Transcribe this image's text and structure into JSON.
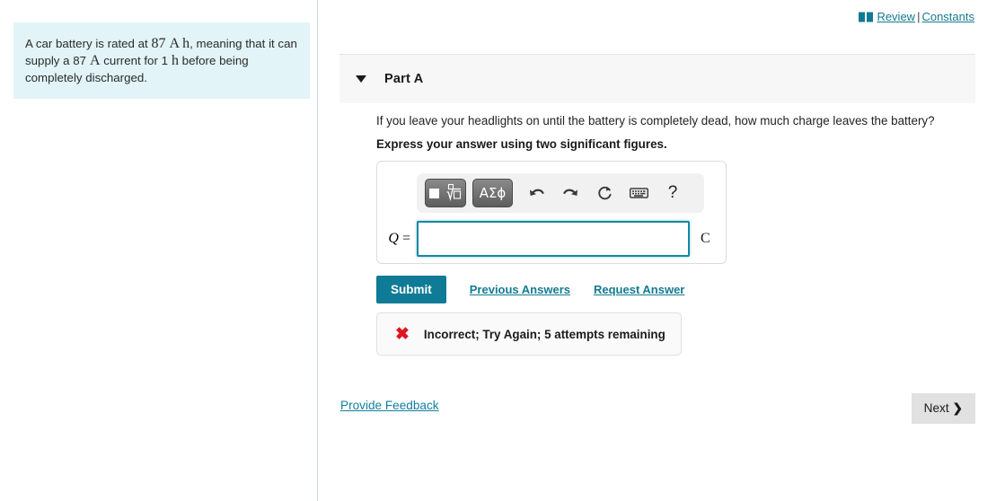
{
  "sidebar": {
    "problem_statement": {
      "part1": "A car battery is rated at ",
      "value1": "87",
      "unit1": "A h",
      "part2": ", meaning that it can supply a ",
      "value2": "87",
      "unit2": "A",
      "part3": " current for ",
      "value3": "1",
      "unit3": "h",
      "part4": " before being completely discharged."
    }
  },
  "header": {
    "book_icon": "book-icon",
    "review_label": "Review",
    "separator": "|",
    "constants_label": "Constants"
  },
  "part": {
    "caret_icon": "chevron-down-icon",
    "title": "Part A",
    "question": "If you leave your headlights on until the battery is completely dead, how much charge leaves the battery?",
    "instruction": "Express your answer using two significant figures."
  },
  "answer": {
    "toolbar": {
      "template_button": "template-nth-root",
      "greek_button": "ΑΣϕ",
      "undo_icon": "undo-icon",
      "redo_icon": "redo-icon",
      "reset_icon": "reset-icon",
      "keyboard_icon": "keyboard-icon",
      "help_label": "?"
    },
    "variable_label": "Q",
    "equals": "=",
    "input_value": "",
    "input_placeholder": "",
    "unit": "C"
  },
  "actions": {
    "submit_label": "Submit",
    "previous_answers_label": "Previous Answers",
    "request_answer_label": "Request Answer"
  },
  "feedback": {
    "icon": "error-x-icon",
    "icon_glyph": "✖",
    "message": "Incorrect; Try Again; 5 attempts remaining"
  },
  "footer": {
    "provide_feedback_label": "Provide Feedback",
    "next_label": "Next",
    "next_chevron": "❯"
  },
  "colors": {
    "accent_teal": "#0f7b96",
    "link_teal": "#137b91",
    "intro_bg": "#e2f4f7",
    "error_red": "#e0141e",
    "panel_gray": "#f7f7f7"
  }
}
